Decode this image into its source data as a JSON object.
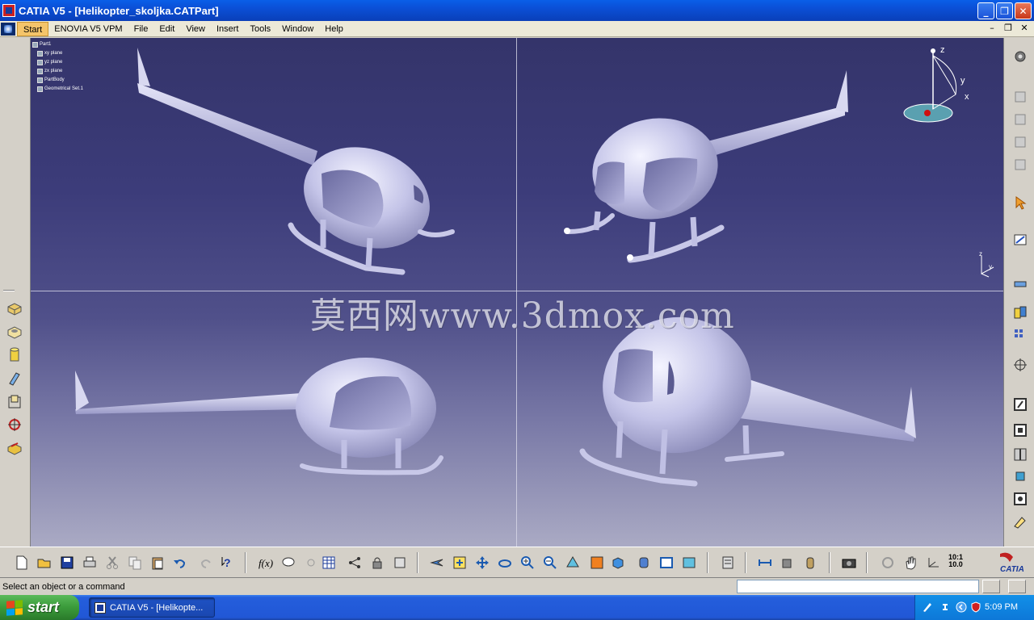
{
  "window": {
    "title": "CATIA V5 - [Helikopter_skoljka.CATPart]"
  },
  "menu": {
    "items": [
      "Start",
      "ENOVIA V5 VPM",
      "File",
      "Edit",
      "View",
      "Insert",
      "Tools",
      "Window",
      "Help"
    ]
  },
  "tree": {
    "root": "Part1",
    "nodes": [
      "xy plane",
      "yz plane",
      "zx plane",
      "PartBody",
      "Geometrical Set.1"
    ]
  },
  "compass": {
    "labels": {
      "x": "x",
      "y": "y",
      "z": "z"
    }
  },
  "axis_indicator": {
    "x": "x",
    "y": "y",
    "z": "z"
  },
  "watermark": "莫西网www.3dmox.com",
  "status": {
    "message": "Select an object or a command",
    "command_value": ""
  },
  "taskbar": {
    "start_label": "start",
    "task_label": "CATIA V5 - [Helikopte...",
    "clock": "5:09 PM"
  },
  "scale_label": {
    "top": "10:1",
    "bottom": "10.0"
  },
  "catia_logo": "CATIA",
  "colors": {
    "title_bar": "#0b4fd6",
    "viewport_top": "#34346a",
    "viewport_bottom": "#aaaac4",
    "model": "#c8c8e8"
  }
}
